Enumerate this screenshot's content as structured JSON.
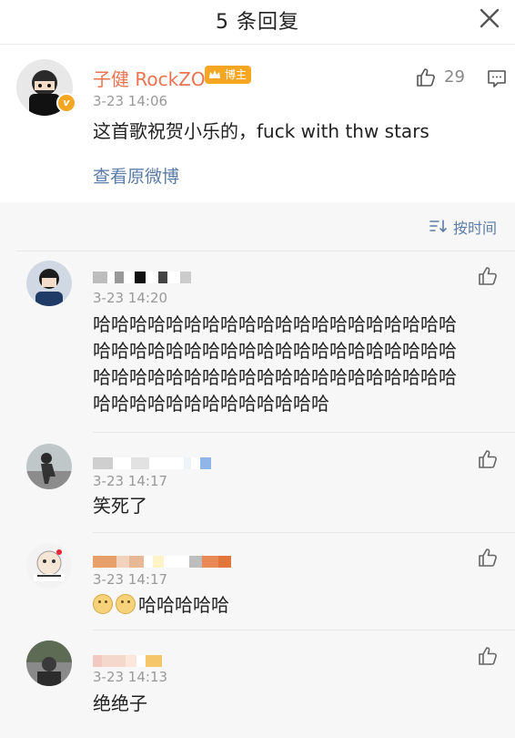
{
  "header": {
    "title": "5 条回复"
  },
  "main_post": {
    "username": "子健 RockZO",
    "badge": "博主",
    "time": "3-23 14:06",
    "content": "这首歌祝贺小乐的，fuck with thw stars",
    "like_count": "29",
    "view_original": "查看原微博"
  },
  "sort": {
    "label": "按时间"
  },
  "comments": [
    {
      "time": "3-23 14:20",
      "lines": [
        "哈哈哈哈哈哈哈哈哈哈哈哈哈哈哈哈哈哈哈哈",
        "哈哈哈哈哈哈哈哈哈哈哈哈哈哈哈哈哈哈哈哈",
        "哈哈哈哈哈哈哈哈哈哈哈哈哈哈哈哈哈哈哈哈",
        "哈哈哈哈哈哈哈哈哈哈哈哈哈"
      ]
    },
    {
      "time": "3-23 14:17",
      "content": "笑死了"
    },
    {
      "time": "3-23 14:17",
      "content": "哈哈哈哈哈",
      "emoji_count": 2
    },
    {
      "time": "3-23 14:13",
      "content": "绝绝子"
    }
  ],
  "colors": {
    "accent": "#eb7350",
    "link": "#5b7ca8",
    "badge": "#f5a623"
  }
}
